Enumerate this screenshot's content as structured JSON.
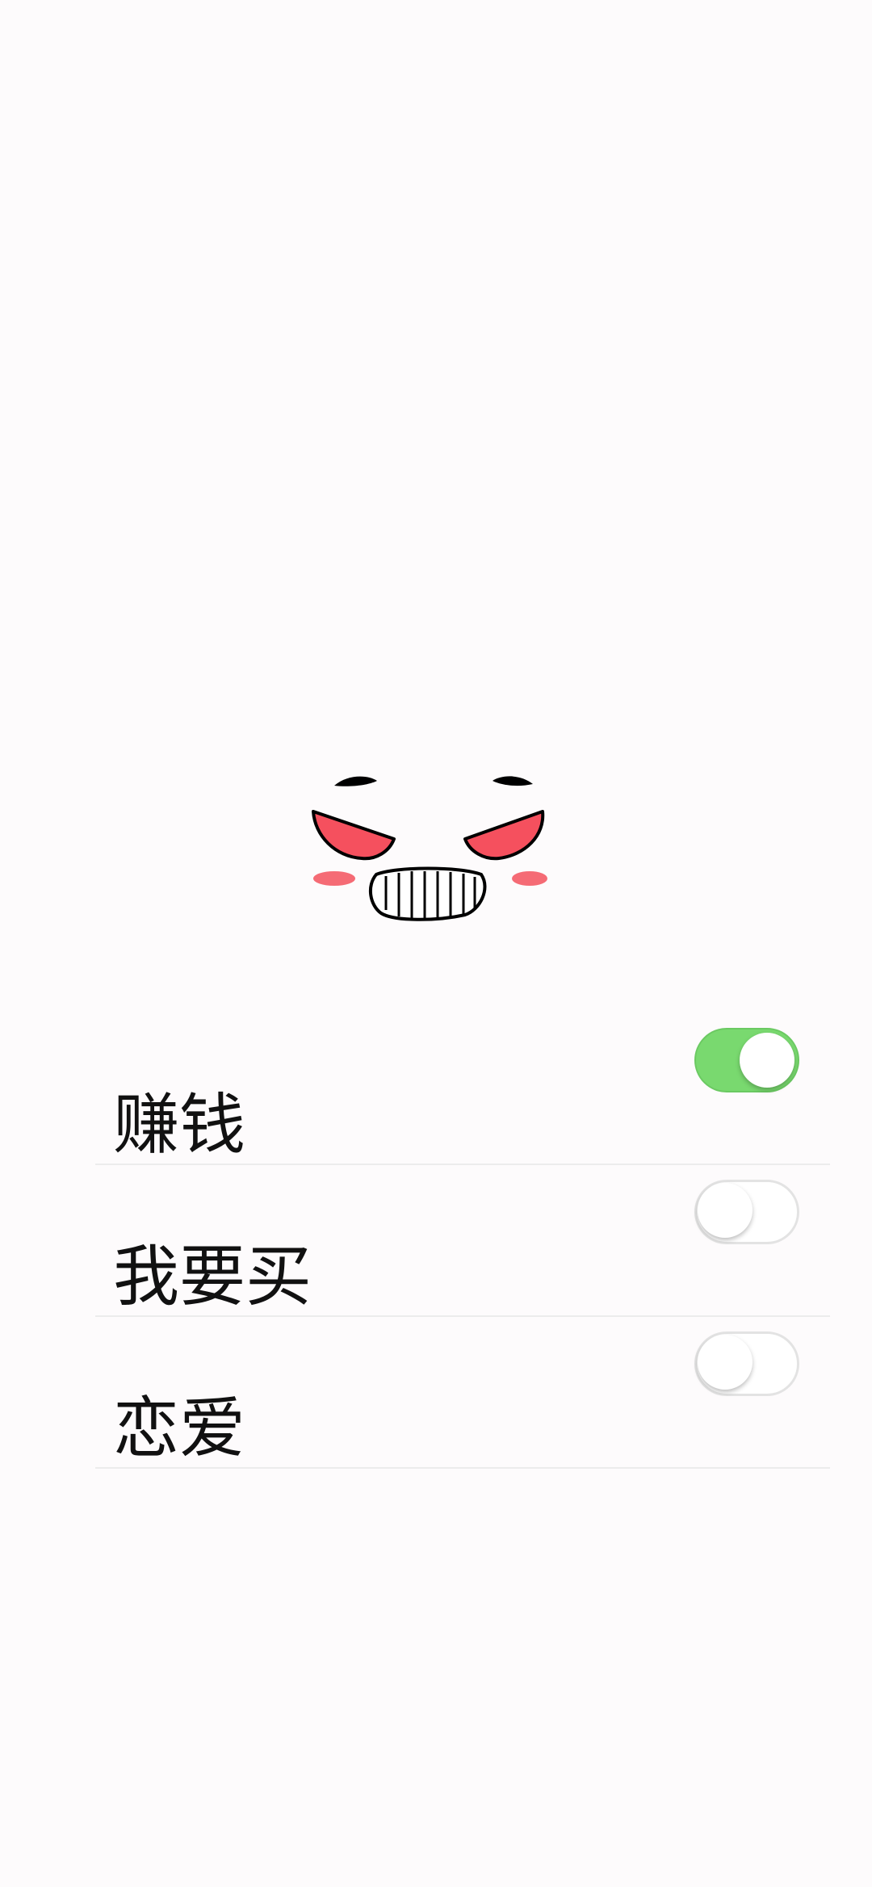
{
  "illustration": {
    "icon": "angry-face-icon",
    "colors": {
      "eyes": "#f5505e",
      "blush": "#f56b75",
      "outline": "#000000"
    }
  },
  "settings": {
    "items": [
      {
        "label": "赚钱",
        "enabled": true
      },
      {
        "label": "我要买",
        "enabled": false
      },
      {
        "label": "恋爱",
        "enabled": false
      }
    ]
  },
  "colors": {
    "background": "#fdfbfc",
    "toggle_on": "#79d96f",
    "divider": "#ececec"
  }
}
